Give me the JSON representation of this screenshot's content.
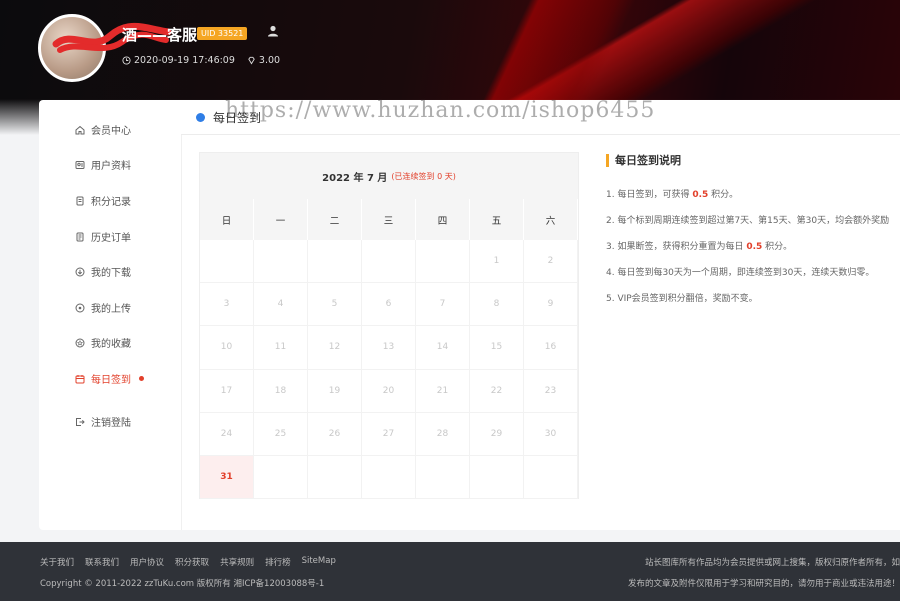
{
  "header": {
    "username": "酒——客服",
    "uid_badge": "UID 33521",
    "timestamp": "2020-09-19 17:46:09",
    "balance": "3.00"
  },
  "sidebar": {
    "items": [
      {
        "label": "会员中心",
        "icon": "home-icon"
      },
      {
        "label": "用户资料",
        "icon": "profile-icon"
      },
      {
        "label": "积分记录",
        "icon": "points-icon"
      },
      {
        "label": "历史订单",
        "icon": "orders-icon"
      },
      {
        "label": "我的下载",
        "icon": "download-icon"
      },
      {
        "label": "我的上传",
        "icon": "upload-icon"
      },
      {
        "label": "我的收藏",
        "icon": "favorites-icon"
      },
      {
        "label": "每日签到",
        "icon": "calendar-icon",
        "active": true
      },
      {
        "label": "注销登陆",
        "icon": "logout-icon"
      }
    ]
  },
  "page": {
    "title": "每日签到",
    "watermark": "https://www.huzhan.com/ishop6455"
  },
  "calendar": {
    "month_label": "2022 年 7 月",
    "streak": "(已连续签到 0 天)",
    "weekdays": [
      "日",
      "一",
      "二",
      "三",
      "四",
      "五",
      "六"
    ],
    "days": [
      "",
      "",
      "",
      "",
      "",
      "1",
      "2",
      "3",
      "4",
      "5",
      "6",
      "7",
      "8",
      "9",
      "10",
      "11",
      "12",
      "13",
      "14",
      "15",
      "16",
      "17",
      "18",
      "19",
      "20",
      "21",
      "22",
      "23",
      "24",
      "25",
      "26",
      "27",
      "28",
      "29",
      "30",
      "31",
      "",
      "",
      "",
      "",
      "",
      ""
    ],
    "today": "31"
  },
  "info": {
    "title": "每日签到说明",
    "line1_pre": "1. 每日签到，可获得 ",
    "line1_hl": "0.5",
    "line1_post": " 积分。",
    "line2": "2. 每个标到周期连续签到超过第7天、第15天、第30天，均会额外奖励",
    "line3_pre": "3. 如果断签，获得积分重置为每日 ",
    "line3_hl": "0.5",
    "line3_post": " 积分。",
    "line4": "4. 每日签到每30天为一个周期，即连续签到30天，连续天数归零。",
    "line5": "5. VIP会员签到积分翻倍，奖励不变。"
  },
  "footer": {
    "links": [
      "关于我们",
      "联系我们",
      "用户协议",
      "积分获取",
      "共享规则",
      "排行榜",
      "SiteMap"
    ],
    "copyright": "Copyright © 2011-2022 zzTuKu.com 版权所有 湘ICP备12003088号-1",
    "right1": "站长图库所有作品均为会员提供或网上搜集，版权归原作者所有，如",
    "right2": "发布的文章及附件仅限用于学习和研究目的，请勿用于商业或违法用途！"
  },
  "colors": {
    "accent": "#e2402b",
    "badge": "#f5a623",
    "title_dot": "#2f7ee6",
    "footer_bg": "#2f3238"
  }
}
